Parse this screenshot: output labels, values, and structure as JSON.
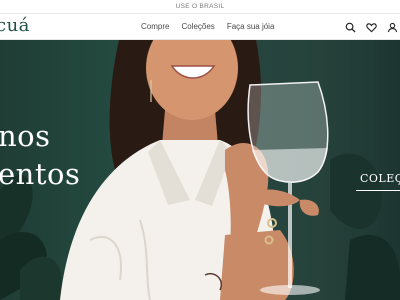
{
  "announcement": "USE O BRASIL",
  "brand": {
    "logo_text": "cuá",
    "color": "#1f4f44"
  },
  "nav": {
    "items": [
      {
        "label": "Compre"
      },
      {
        "label": "Coleções"
      },
      {
        "label": "Faça sua jóia"
      }
    ]
  },
  "header_icons": [
    "search-icon",
    "heart-icon",
    "user-icon"
  ],
  "hero": {
    "line1": "nos",
    "line2": "entos",
    "side_label": "COLEÇ"
  },
  "colors": {
    "hero_background": "#244a40",
    "shirt": "#f4f1ec",
    "skin": "#c98a68"
  }
}
